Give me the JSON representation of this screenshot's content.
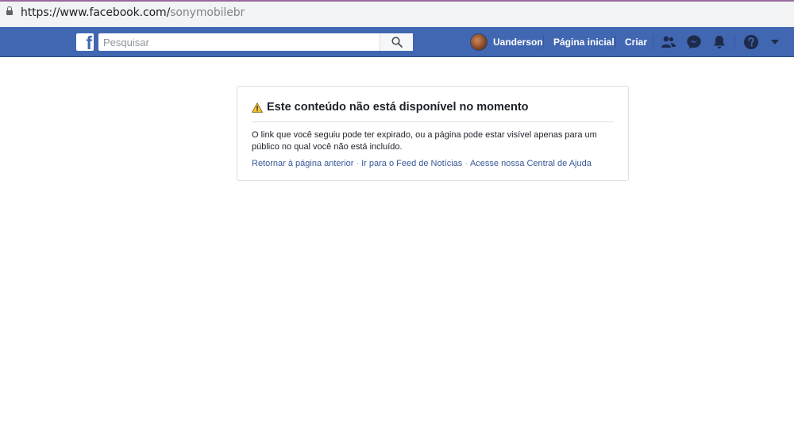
{
  "browser": {
    "url_host": "https://www.facebook.com/",
    "url_path": "sonymobilebr"
  },
  "topbar": {
    "logo_letter": "f",
    "search_placeholder": "Pesquisar",
    "user_name": "Uanderson",
    "home_label": "Página inicial",
    "create_label": "Criar",
    "icons": [
      "friends-icon",
      "messenger-icon",
      "notifications-icon",
      "help-icon",
      "account-menu-icon"
    ]
  },
  "error": {
    "title": "Este conteúdo não está disponível no momento",
    "message": "O link que você seguiu pode ter expirado, ou a página pode estar visível apenas para um público no qual você não está incluído.",
    "links": {
      "back": "Retornar à página anterior",
      "feed": "Ir para o Feed de Notícias",
      "help": "Acesse nossa Central de Ajuda"
    },
    "separator": "·"
  },
  "colors": {
    "brand_blue": "#4267b2",
    "link_blue": "#385898",
    "warning_yellow": "#f5c33b"
  }
}
